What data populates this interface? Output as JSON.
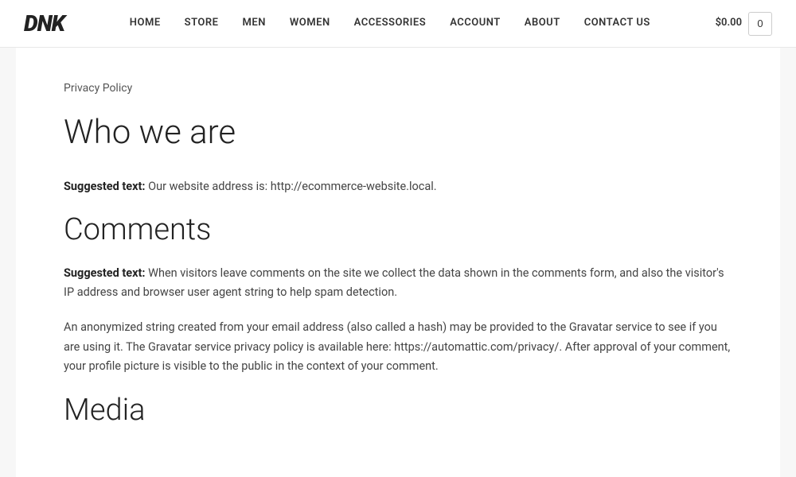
{
  "header": {
    "logo": "DNK",
    "nav": {
      "items": [
        {
          "label": "HOME",
          "id": "home"
        },
        {
          "label": "STORE",
          "id": "store"
        },
        {
          "label": "MEN",
          "id": "men"
        },
        {
          "label": "WOMEN",
          "id": "women"
        },
        {
          "label": "ACCESSORIES",
          "id": "accessories"
        },
        {
          "label": "ACCOUNT",
          "id": "account"
        },
        {
          "label": "ABOUT",
          "id": "about"
        },
        {
          "label": "CONTACT US",
          "id": "contact-us"
        }
      ]
    },
    "cart": {
      "price": "$0.00",
      "count": "0"
    }
  },
  "content": {
    "subtitle": "Privacy Policy",
    "who_we_are": {
      "heading": "Who we are",
      "suggested_label": "Suggested text:",
      "suggested_text": " Our website address is: http://ecommerce-website.local."
    },
    "comments": {
      "heading": "Comments",
      "suggested_label": "Suggested text:",
      "suggested_text": " When visitors leave comments on the site we collect the data shown in the comments form, and also the visitor's IP address and browser user agent string to help spam detection.",
      "body": "An anonymized string created from your email address (also called a hash) may be provided to the Gravatar service to see if you are using it. The Gravatar service privacy policy is available here: https://automattic.com/privacy/. After approval of your comment, your profile picture is visible to the public in the context of your comment."
    },
    "media": {
      "heading": "Media"
    }
  }
}
